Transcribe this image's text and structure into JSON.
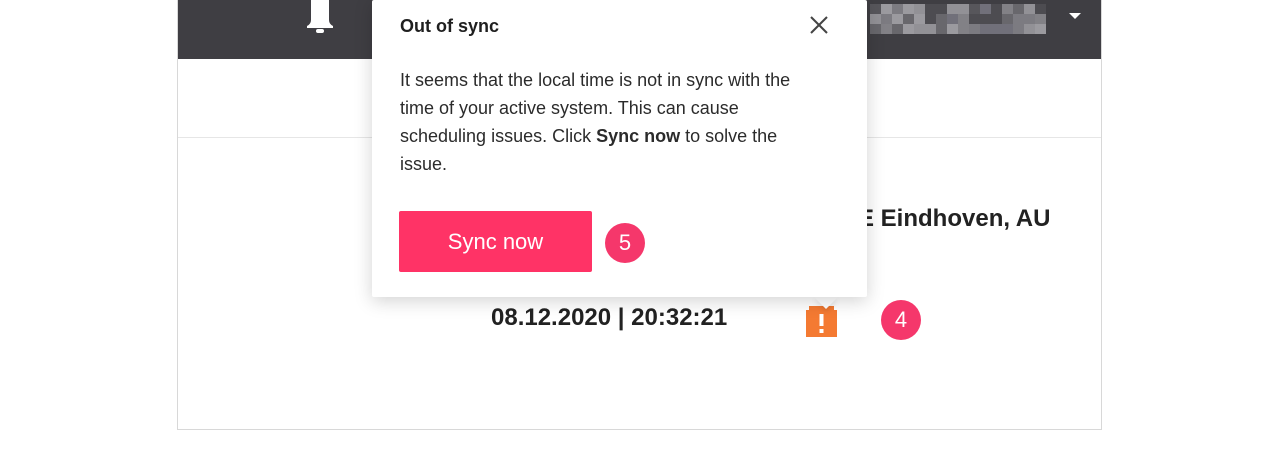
{
  "header": {
    "bell_icon": "bell-icon",
    "user_menu_icon": "caret-down-icon"
  },
  "main": {
    "location": "E Eindhoven, AU",
    "datetime": "08.12.2020 | 20:32:21",
    "warning_icon": "warning-icon",
    "warning_color": "#f47a32"
  },
  "popover": {
    "title": "Out of sync",
    "close_icon": "close-icon",
    "body_before": "It seems that the local time is not in sync with the time of your active system. This can cause scheduling issues. Click ",
    "body_bold": "Sync now",
    "body_after": " to solve the issue.",
    "button_label": "Sync now",
    "button_color": "#ff3366"
  },
  "annotations": {
    "badge_button": "5",
    "badge_warning": "4",
    "badge_color": "#f5376b"
  }
}
